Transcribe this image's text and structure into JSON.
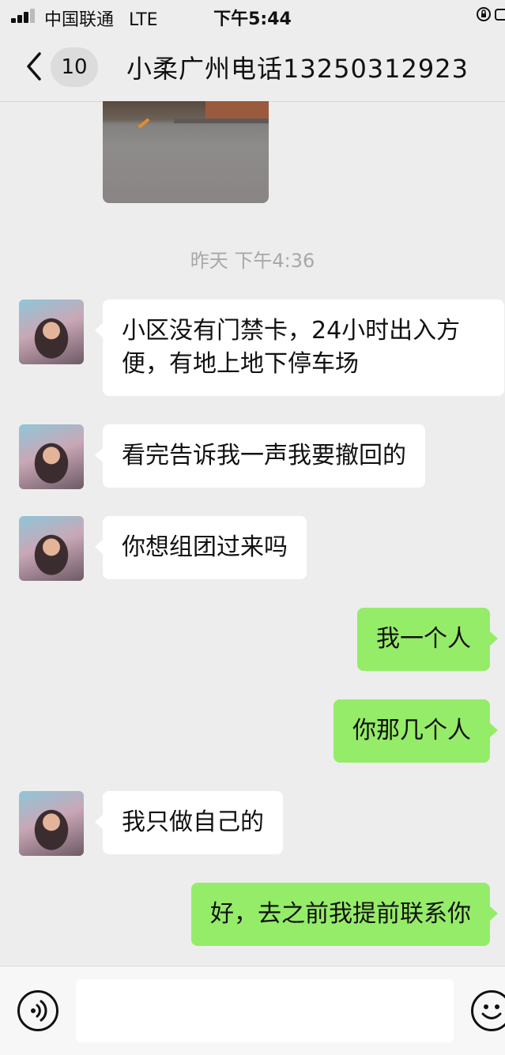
{
  "status_bar": {
    "carrier": "中国联通",
    "network": "LTE",
    "time": "下午5:44"
  },
  "nav": {
    "unread_count": "10",
    "title": "小柔广州电话13250312923"
  },
  "timestamp": "昨天 下午4:36",
  "messages": [
    {
      "side": "left",
      "text": "小区没有门禁卡，24小时出入方便，有地上地下停车场"
    },
    {
      "side": "left",
      "text": "看完告诉我一声我要撤回的"
    },
    {
      "side": "left",
      "text": "你想组团过来吗"
    },
    {
      "side": "right",
      "text": "我一个人"
    },
    {
      "side": "right",
      "text": "你那几个人"
    },
    {
      "side": "left",
      "text": "我只做自己的"
    },
    {
      "side": "right",
      "text": "好，去之前我提前联系你"
    }
  ],
  "input": {
    "value": ""
  },
  "colors": {
    "background": "#ededed",
    "outgoing_bubble": "#95ec69",
    "incoming_bubble": "#ffffff",
    "timestamp": "#a8a8a8"
  },
  "icons": [
    "signal-icon",
    "lock-icon",
    "battery-icon",
    "back-icon",
    "voice-icon",
    "emoji-icon"
  ]
}
